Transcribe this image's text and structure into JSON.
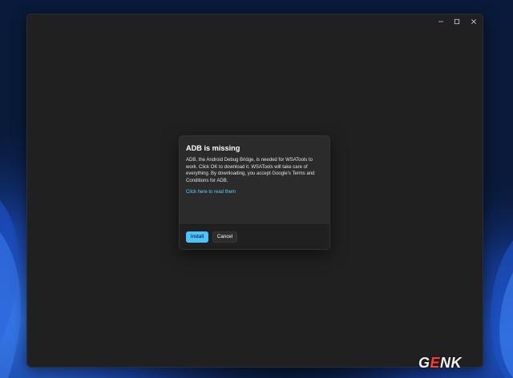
{
  "window": {
    "controls": {
      "minimize_icon": "minimize-icon",
      "maximize_icon": "maximize-icon",
      "close_icon": "close-icon"
    }
  },
  "dialog": {
    "title": "ADB is missing",
    "message": "ADB, the Android Debug Bridge, is needed for WSATools to work. Click OK to download it. WSATools will take care of everything. By downloading, you accept Google's Terms and Conditions for ADB.",
    "link_text": "Click here to read them",
    "primary_button": "Install",
    "secondary_button": "Cancel"
  },
  "watermark": {
    "logo_pre": "G",
    "logo_accent": "E",
    "logo_post": "NK"
  },
  "colors": {
    "desktop_background": "#091a3a",
    "window_background": "#202020",
    "dialog_background": "#2b2b2b",
    "accent": "#4cc2ff",
    "link": "#60cdff",
    "logo_accent": "#ff3b30"
  }
}
